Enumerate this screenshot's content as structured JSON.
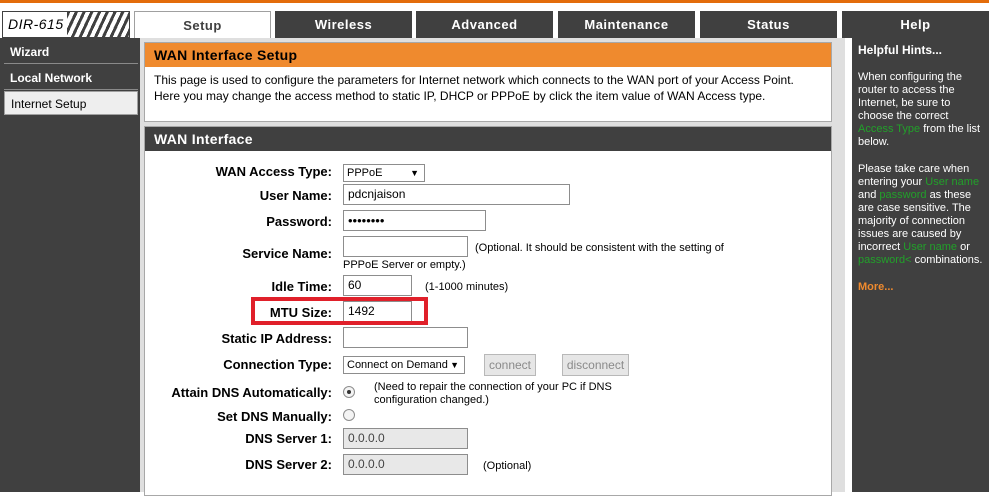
{
  "brand": {
    "model": "DIR-615"
  },
  "nav": {
    "tabs": [
      {
        "label": "Setup"
      },
      {
        "label": "Wireless"
      },
      {
        "label": "Advanced"
      },
      {
        "label": "Maintenance"
      },
      {
        "label": "Status"
      },
      {
        "label": "Help"
      }
    ],
    "active_tab": "Setup"
  },
  "sidebar": {
    "items": [
      {
        "label": "Wizard"
      },
      {
        "label": "Local Network"
      },
      {
        "label": "Internet Setup"
      }
    ],
    "active_item": "Internet Setup"
  },
  "intro_box": {
    "title": "WAN Interface Setup",
    "text_line1": "This page is used to configure the parameters for Internet network which connects to the WAN port of your Access Point.",
    "text_line2": "Here you may change the access method to static IP, DHCP or PPPoE by click the item value of WAN Access type."
  },
  "wan": {
    "title": "WAN Interface",
    "access_type": {
      "label": "WAN Access Type:",
      "value": "PPPoE"
    },
    "user_name": {
      "label": "User Name:",
      "value": "pdcnjaison"
    },
    "password": {
      "label": "Password:",
      "value": "••••••••"
    },
    "service_name": {
      "label": "Service Name:",
      "value": "",
      "note_line1": "(Optional. It should be consistent with the setting of",
      "note_line2": "PPPoE Server or empty.)"
    },
    "idle_time": {
      "label": "Idle Time:",
      "value": "60",
      "note": "(1-1000 minutes)"
    },
    "mtu_size": {
      "label": "MTU Size:",
      "value": "1492"
    },
    "static_ip": {
      "label": "Static IP Address:",
      "value": ""
    },
    "connection_type": {
      "label": "Connection Type:",
      "value": "Connect on Demand",
      "connect_label": "connect",
      "disconnect_label": "disconnect"
    },
    "attain_dns": {
      "label": "Attain DNS Automatically:",
      "selected": true,
      "note_line1": "(Need to repair the connection of your PC if DNS",
      "note_line2": "configuration changed.)"
    },
    "set_dns": {
      "label": "Set DNS Manually:",
      "selected": false
    },
    "dns1": {
      "label": "DNS Server 1:",
      "value": "0.0.0.0"
    },
    "dns2": {
      "label": "DNS Server 2:",
      "value": "0.0.0.0",
      "note": "(Optional)"
    }
  },
  "hints": {
    "title": "Helpful Hints...",
    "p1_a": "When configuring the router to access the Internet, be sure to choose the correct",
    "p1_hl": "Access Type",
    "p1_b": "from the list below.",
    "p2_a": "Please take care when entering your",
    "p2_hl1": "User name",
    "p2_and": "and",
    "p2_hl2": "password",
    "p2_b": "as these are case sensitive. The majority of connection issues are caused by incorrect",
    "p2_hl3": "User name",
    "p2_or": "or",
    "p2_hl4": "password<",
    "p2_c": "combinations.",
    "more": "More..."
  },
  "colors": {
    "accent_orange": "#ef8a2e",
    "nav_dark": "#404040",
    "highlight_red": "#e0202a",
    "hint_green": "#22a02a"
  }
}
